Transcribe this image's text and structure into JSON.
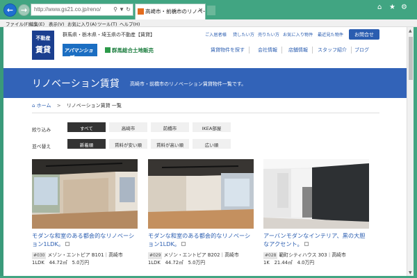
{
  "browser": {
    "url": "http://www.gs21.co.jp/reno/",
    "tab_title": "高崎市・前橋市のリノベーショ...",
    "menu": [
      "ファイル(F)",
      "編集(E)",
      "表示(V)",
      "お気に入り(A)",
      "ツール(T)",
      "ヘルプ(H)"
    ]
  },
  "header": {
    "logo_line1": "不動産",
    "logo_line2": "賃貸",
    "region": "群馬県・栃木県・埼玉県の不動産【賃貸】",
    "apaman": "アパマンショップ",
    "gunma": "群馬総合土地販売",
    "toplinks": [
      "ご入居者様",
      "貸したい方",
      "売りたい方",
      "お気に入り物件",
      "最近見た物件"
    ],
    "inquiry": "お問合せ",
    "nav": [
      "賃貸物件を探す",
      "会社情報",
      "店舗情報",
      "スタッフ紹介",
      "ブログ"
    ]
  },
  "banner": {
    "title": "リノベーション賃貸",
    "subtitle": "高崎市・前橋市のリノベーション賃貸物件一覧です。"
  },
  "breadcrumb": {
    "home": "ホーム",
    "current": "リノベーション賃貸 一覧"
  },
  "filters": {
    "narrow_label": "絞り込み",
    "narrow": [
      "すべて",
      "高崎市",
      "前橋市",
      "IKEA部屋"
    ],
    "sort_label": "並べ替え",
    "sort": [
      "新着順",
      "賃料が安い順",
      "賃料が高い順",
      "広い順"
    ]
  },
  "cards": [
    {
      "title": "モダンな和室のある都会的なリノベーション1LDK。",
      "no": "#030",
      "name": "メゾン・エントピア B101｜高崎市",
      "spec": "1LDK　44.72㎡　5.0万円"
    },
    {
      "title": "モダンな和室のある都会的なリノベーション1LDK。",
      "no": "#029",
      "name": "メゾン・エントピア B202｜高崎市",
      "spec": "1LDK　44.72㎡　5.0万円"
    },
    {
      "title": "アーバンモダンなインテリア、黒の大胆なアクセント。",
      "no": "#028",
      "name": "範町シティハウス 303｜高崎市",
      "spec": "1K　21.44㎡　4.0万円"
    }
  ]
}
